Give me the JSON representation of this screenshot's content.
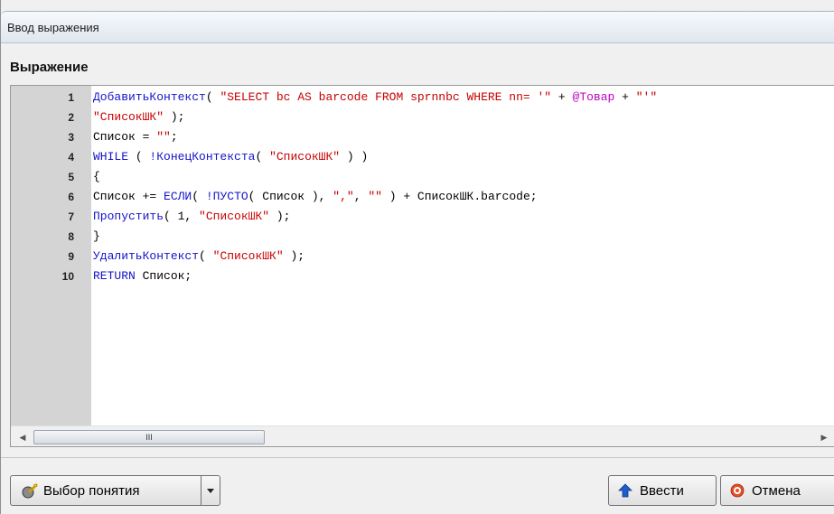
{
  "window": {
    "title": "Ввод выражения"
  },
  "section": {
    "label": "Выражение"
  },
  "editor": {
    "line_numbers": [
      "1",
      "2",
      "3",
      "4",
      "5",
      "6",
      "7",
      "8",
      "9",
      "10"
    ],
    "lines": [
      [
        {
          "t": "ДобавитьКонтекст",
          "c": "kw"
        },
        {
          "t": "( ",
          "c": "plain"
        },
        {
          "t": "\"SELECT bc AS barcode FROM sprnnbc WHERE nn= '\"",
          "c": "str"
        },
        {
          "t": " + ",
          "c": "op"
        },
        {
          "t": "@Товар",
          "c": "var"
        },
        {
          "t": " + ",
          "c": "op"
        },
        {
          "t": "\"'\"",
          "c": "str"
        }
      ],
      [
        {
          "t": "\"СписокШК\"",
          "c": "str"
        },
        {
          "t": " );",
          "c": "plain"
        }
      ],
      [
        {
          "t": "Список",
          "c": "plain"
        },
        {
          "t": " = ",
          "c": "op"
        },
        {
          "t": "\"\"",
          "c": "str"
        },
        {
          "t": ";",
          "c": "plain"
        }
      ],
      [
        {
          "t": "WHILE",
          "c": "kw"
        },
        {
          "t": " ( ",
          "c": "plain"
        },
        {
          "t": "!КонецКонтекста",
          "c": "kw"
        },
        {
          "t": "( ",
          "c": "plain"
        },
        {
          "t": "\"СписокШК\"",
          "c": "str"
        },
        {
          "t": " ) )",
          "c": "plain"
        }
      ],
      [
        {
          "t": "{",
          "c": "plain"
        }
      ],
      [
        {
          "t": "Список",
          "c": "plain"
        },
        {
          "t": " += ",
          "c": "op"
        },
        {
          "t": "ЕСЛИ",
          "c": "kw"
        },
        {
          "t": "( ",
          "c": "plain"
        },
        {
          "t": "!ПУСТО",
          "c": "kw"
        },
        {
          "t": "( Список ), ",
          "c": "plain"
        },
        {
          "t": "\",\"",
          "c": "str"
        },
        {
          "t": ", ",
          "c": "plain"
        },
        {
          "t": "\"\"",
          "c": "str"
        },
        {
          "t": " ) + СписокШК.barcode;",
          "c": "plain"
        }
      ],
      [
        {
          "t": "Пропустить",
          "c": "kw"
        },
        {
          "t": "( 1, ",
          "c": "plain"
        },
        {
          "t": "\"СписокШК\"",
          "c": "str"
        },
        {
          "t": " );",
          "c": "plain"
        }
      ],
      [
        {
          "t": "}",
          "c": "plain"
        }
      ],
      [
        {
          "t": "УдалитьКонтекст",
          "c": "kw"
        },
        {
          "t": "( ",
          "c": "plain"
        },
        {
          "t": "\"СписокШК\"",
          "c": "str"
        },
        {
          "t": " );",
          "c": "plain"
        }
      ],
      [
        {
          "t": "RETURN",
          "c": "kw"
        },
        {
          "t": " Список;",
          "c": "plain"
        }
      ]
    ]
  },
  "scrollbar": {
    "left_arrow": "◀",
    "right_arrow": "▶",
    "thumb_grip": "III",
    "position": 0.0
  },
  "buttons": {
    "concept_label": "Выбор понятия",
    "enter_label": "Ввести",
    "cancel_label": "Отмена"
  },
  "colors": {
    "keyword": "#1414cc",
    "string": "#c80000",
    "variable": "#c000c0",
    "gutter": "#d4d4d4",
    "accent": "#1e5cc8"
  }
}
